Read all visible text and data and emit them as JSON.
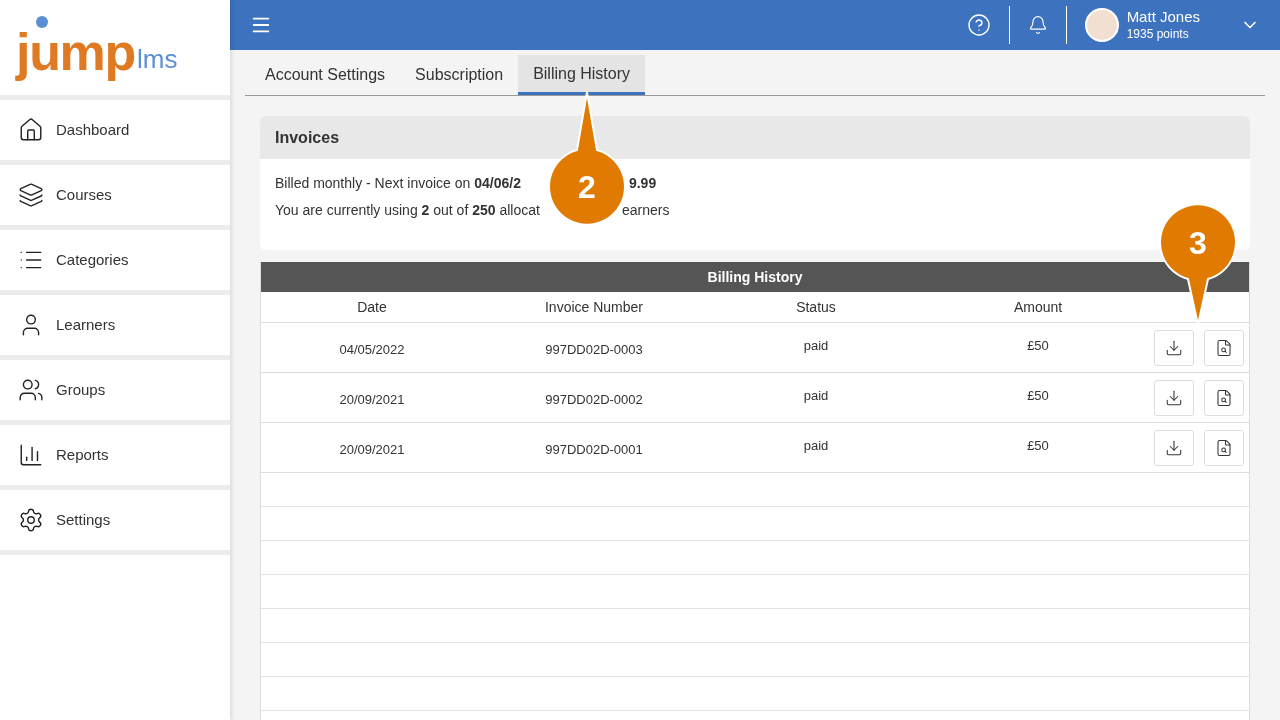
{
  "logo": {
    "main": "jump",
    "suffix": "lms"
  },
  "sidebar": {
    "items": [
      {
        "label": "Dashboard",
        "kind": "home"
      },
      {
        "label": "Courses",
        "kind": "layers"
      },
      {
        "label": "Categories",
        "kind": "list"
      },
      {
        "label": "Learners",
        "kind": "person"
      },
      {
        "label": "Groups",
        "kind": "group"
      },
      {
        "label": "Reports",
        "kind": "chart"
      },
      {
        "label": "Settings",
        "kind": "gear"
      }
    ]
  },
  "user": {
    "name": "Matt Jones",
    "points": "1935 points"
  },
  "tabs": [
    {
      "label": "Account Settings",
      "selected": false
    },
    {
      "label": "Subscription",
      "selected": false
    },
    {
      "label": "Billing History",
      "selected": true
    }
  ],
  "invoices": {
    "title": "Invoices",
    "lines": [
      [
        "Billed monthly - Next invoice on **04/06/2**",
        "**9.99**"
      ],
      [
        "You are currently using **2** out of **250** allocat",
        "earners"
      ]
    ]
  },
  "billing": {
    "title": "Billing History",
    "columns": [
      "Date",
      "Invoice Number",
      "Status",
      "Amount"
    ],
    "rows": [
      [
        "04/05/2022",
        "997DD02D-0003",
        "paid",
        "£50"
      ],
      [
        "20/09/2021",
        "997DD02D-0002",
        "paid",
        "£50"
      ],
      [
        "20/09/2021",
        "997DD02D-0001",
        "paid",
        "£50"
      ]
    ]
  },
  "callouts": [
    {
      "number": "2",
      "kind": "up"
    },
    {
      "number": "3",
      "kind": "down"
    }
  ]
}
